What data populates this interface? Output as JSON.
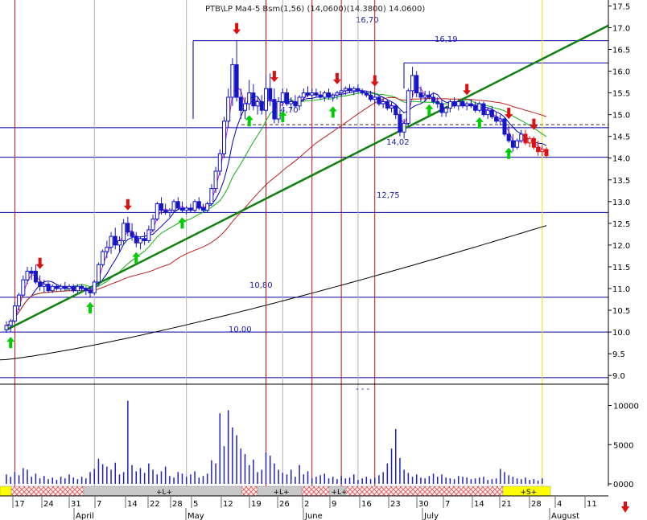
{
  "title_text": "PTB\\LP Ma4-5 Bsm(1,56) (14,0600)(14.3800) 14.0600)",
  "dashes_text": "- - -",
  "colors": {
    "up_candle": "#1414c8",
    "down_candle": "#e01010",
    "ma_short": "#d020d0",
    "ma_mid": "#0000c0",
    "ma_green": "#10b010",
    "ma_red": "#c02020",
    "ma_long": "#000000",
    "trend_line": "#108010",
    "level_line": "#0000a0",
    "vline_red": "#d01010",
    "vline_yellow": "#f0e000",
    "vline_gray": "#b0b0b0",
    "volume_bar": "#2020c0",
    "arrow_up": "#00cc00",
    "arrow_down": "#dd1010",
    "band_yellow": "#ffff00",
    "band_gray": "#c8c8c8",
    "band_hatch": "#ff8888"
  },
  "chart_data": {
    "type": "candlestick",
    "price_axis": {
      "ticks": [
        "17.5",
        "17.0",
        "16.5",
        "16.0",
        "15.5",
        "15.0",
        "14.5",
        "14.0",
        "13.5",
        "13.0",
        "12.5",
        "12.0",
        "11.5",
        "11.0",
        "10.5",
        "10.0",
        "9.5",
        "9.0"
      ],
      "range": [
        8.8,
        17.6
      ]
    },
    "volume_axis": {
      "ticks": [
        "10000",
        "5000",
        "0000"
      ],
      "range": [
        0,
        12000
      ]
    },
    "x_axis": {
      "day_ticks": [
        "17",
        "24",
        "31",
        "7",
        "14",
        "22",
        "28",
        "5",
        "12",
        "19",
        "26",
        "2",
        "9",
        "16",
        "23",
        "30",
        "7",
        "14",
        "21",
        "28",
        "4",
        "11"
      ],
      "months": [
        "April",
        "May",
        "June",
        "July",
        "August"
      ]
    },
    "levels": [
      {
        "value": 16.7,
        "label": "16,70"
      },
      {
        "value": 16.19,
        "label": "16,19"
      },
      {
        "value": 14.7,
        "label": "14,70"
      },
      {
        "value": 14.02,
        "label": "14,02"
      },
      {
        "value": 12.75,
        "label": "12,75"
      },
      {
        "value": 10.8,
        "label": "10,80"
      },
      {
        "value": 10.0,
        "label": "10,00"
      }
    ],
    "dashed_level": 14.77,
    "extra_level": 8.95,
    "trend_line": {
      "start": [
        0,
        10.05
      ],
      "end": [
        113,
        17.05
      ]
    },
    "vertical_lines": [
      {
        "day": 2,
        "kind": "red"
      },
      {
        "day": 21,
        "kind": "gray"
      },
      {
        "day": 43,
        "kind": "gray"
      },
      {
        "day": 62,
        "kind": "red"
      },
      {
        "day": 66,
        "kind": "gray"
      },
      {
        "day": 73,
        "kind": "red"
      },
      {
        "day": 80,
        "kind": "red"
      },
      {
        "day": 84,
        "kind": "gray"
      },
      {
        "day": 88,
        "kind": "red"
      },
      {
        "day": 128,
        "kind": "yellow"
      }
    ],
    "candles": [
      {
        "o": 10.05,
        "h": 10.25,
        "l": 9.98,
        "c": 10.15
      },
      {
        "o": 10.15,
        "h": 10.3,
        "l": 10.0,
        "c": 10.25
      },
      {
        "o": 10.25,
        "h": 10.7,
        "l": 10.2,
        "c": 10.6
      },
      {
        "o": 10.6,
        "h": 10.9,
        "l": 10.5,
        "c": 10.85
      },
      {
        "o": 10.85,
        "h": 11.3,
        "l": 10.8,
        "c": 11.2
      },
      {
        "o": 11.2,
        "h": 11.5,
        "l": 11.1,
        "c": 11.4
      },
      {
        "o": 11.4,
        "h": 11.5,
        "l": 11.2,
        "c": 11.35
      },
      {
        "o": 11.4,
        "h": 11.55,
        "l": 11.1,
        "c": 11.15
      },
      {
        "o": 11.15,
        "h": 11.3,
        "l": 10.95,
        "c": 11.05
      },
      {
        "o": 11.05,
        "h": 11.2,
        "l": 10.9,
        "c": 11.1
      },
      {
        "o": 11.1,
        "h": 11.15,
        "l": 10.9,
        "c": 10.95
      },
      {
        "o": 10.95,
        "h": 11.1,
        "l": 10.9,
        "c": 11.05
      },
      {
        "o": 11.05,
        "h": 11.1,
        "l": 10.95,
        "c": 11.0
      },
      {
        "o": 11.0,
        "h": 11.1,
        "l": 10.95,
        "c": 11.05
      },
      {
        "o": 11.05,
        "h": 11.15,
        "l": 10.95,
        "c": 11.0
      },
      {
        "o": 11.0,
        "h": 11.1,
        "l": 10.95,
        "c": 11.05
      },
      {
        "o": 11.05,
        "h": 11.1,
        "l": 10.9,
        "c": 10.95
      },
      {
        "o": 10.95,
        "h": 11.1,
        "l": 10.9,
        "c": 11.05
      },
      {
        "o": 11.05,
        "h": 11.1,
        "l": 10.95,
        "c": 11.0
      },
      {
        "o": 11.0,
        "h": 11.05,
        "l": 10.85,
        "c": 10.95
      },
      {
        "o": 10.95,
        "h": 11.05,
        "l": 10.8,
        "c": 10.9
      },
      {
        "o": 10.9,
        "h": 11.2,
        "l": 10.85,
        "c": 11.15
      },
      {
        "o": 11.15,
        "h": 11.6,
        "l": 11.1,
        "c": 11.55
      },
      {
        "o": 11.55,
        "h": 11.9,
        "l": 11.5,
        "c": 11.85
      },
      {
        "o": 11.85,
        "h": 12.1,
        "l": 11.7,
        "c": 11.95
      },
      {
        "o": 11.95,
        "h": 12.3,
        "l": 11.8,
        "c": 12.2
      },
      {
        "o": 12.2,
        "h": 12.4,
        "l": 11.9,
        "c": 12.0
      },
      {
        "o": 12.0,
        "h": 12.2,
        "l": 11.85,
        "c": 12.1
      },
      {
        "o": 12.1,
        "h": 12.6,
        "l": 12.0,
        "c": 12.5
      },
      {
        "o": 12.5,
        "h": 12.65,
        "l": 12.2,
        "c": 12.3
      },
      {
        "o": 12.3,
        "h": 12.5,
        "l": 12.1,
        "c": 12.2
      },
      {
        "o": 12.2,
        "h": 12.3,
        "l": 11.95,
        "c": 12.05
      },
      {
        "o": 12.05,
        "h": 12.2,
        "l": 11.9,
        "c": 12.15
      },
      {
        "o": 12.15,
        "h": 12.3,
        "l": 12.0,
        "c": 12.1
      },
      {
        "o": 12.1,
        "h": 12.45,
        "l": 12.05,
        "c": 12.35
      },
      {
        "o": 12.35,
        "h": 12.7,
        "l": 12.3,
        "c": 12.6
      },
      {
        "o": 12.6,
        "h": 13.0,
        "l": 12.55,
        "c": 12.95
      },
      {
        "o": 12.95,
        "h": 13.1,
        "l": 12.7,
        "c": 12.8
      },
      {
        "o": 12.8,
        "h": 12.95,
        "l": 12.7,
        "c": 12.75
      },
      {
        "o": 12.75,
        "h": 12.85,
        "l": 12.65,
        "c": 12.8
      },
      {
        "o": 12.8,
        "h": 13.05,
        "l": 12.75,
        "c": 13.0
      },
      {
        "o": 13.0,
        "h": 13.1,
        "l": 12.8,
        "c": 12.85
      },
      {
        "o": 12.85,
        "h": 13.0,
        "l": 12.75,
        "c": 12.8
      },
      {
        "o": 12.8,
        "h": 12.9,
        "l": 12.7,
        "c": 12.85
      },
      {
        "o": 12.85,
        "h": 12.95,
        "l": 12.75,
        "c": 12.8
      },
      {
        "o": 12.8,
        "h": 13.05,
        "l": 12.75,
        "c": 13.0
      },
      {
        "o": 13.0,
        "h": 13.1,
        "l": 12.8,
        "c": 12.85
      },
      {
        "o": 12.85,
        "h": 12.95,
        "l": 12.75,
        "c": 12.8
      },
      {
        "o": 12.8,
        "h": 13.0,
        "l": 12.75,
        "c": 12.95
      },
      {
        "o": 12.95,
        "h": 13.4,
        "l": 12.9,
        "c": 13.3
      },
      {
        "o": 13.3,
        "h": 13.8,
        "l": 13.2,
        "c": 13.7
      },
      {
        "o": 13.7,
        "h": 14.2,
        "l": 13.6,
        "c": 14.1
      },
      {
        "o": 14.1,
        "h": 14.95,
        "l": 14.0,
        "c": 14.85
      },
      {
        "o": 14.85,
        "h": 15.6,
        "l": 14.7,
        "c": 15.4
      },
      {
        "o": 15.4,
        "h": 16.3,
        "l": 15.2,
        "c": 16.15
      },
      {
        "o": 16.15,
        "h": 16.7,
        "l": 15.3,
        "c": 15.4
      },
      {
        "o": 15.4,
        "h": 15.6,
        "l": 14.9,
        "c": 15.1
      },
      {
        "o": 15.1,
        "h": 15.4,
        "l": 14.9,
        "c": 15.25
      },
      {
        "o": 15.25,
        "h": 15.8,
        "l": 15.1,
        "c": 15.5
      },
      {
        "o": 15.5,
        "h": 15.7,
        "l": 15.1,
        "c": 15.2
      },
      {
        "o": 15.2,
        "h": 15.4,
        "l": 15.0,
        "c": 15.3
      },
      {
        "o": 15.3,
        "h": 15.45,
        "l": 15.0,
        "c": 15.1
      },
      {
        "o": 15.1,
        "h": 15.9,
        "l": 15.0,
        "c": 15.6
      },
      {
        "o": 15.6,
        "h": 15.95,
        "l": 15.2,
        "c": 15.35
      },
      {
        "o": 15.35,
        "h": 15.6,
        "l": 14.8,
        "c": 14.9
      },
      {
        "o": 14.9,
        "h": 15.4,
        "l": 14.8,
        "c": 15.3
      },
      {
        "o": 15.3,
        "h": 15.6,
        "l": 15.2,
        "c": 15.5
      },
      {
        "o": 15.5,
        "h": 15.6,
        "l": 15.2,
        "c": 15.25
      },
      {
        "o": 15.25,
        "h": 15.4,
        "l": 15.1,
        "c": 15.3
      },
      {
        "o": 15.3,
        "h": 15.45,
        "l": 15.15,
        "c": 15.2
      },
      {
        "o": 15.2,
        "h": 15.45,
        "l": 15.1,
        "c": 15.4
      },
      {
        "o": 15.4,
        "h": 15.6,
        "l": 15.3,
        "c": 15.5
      },
      {
        "o": 15.5,
        "h": 15.65,
        "l": 15.4,
        "c": 15.45
      },
      {
        "o": 15.45,
        "h": 15.6,
        "l": 15.35,
        "c": 15.5
      },
      {
        "o": 15.5,
        "h": 15.6,
        "l": 15.4,
        "c": 15.45
      },
      {
        "o": 15.45,
        "h": 15.55,
        "l": 15.35,
        "c": 15.4
      },
      {
        "o": 15.4,
        "h": 15.55,
        "l": 15.3,
        "c": 15.5
      },
      {
        "o": 15.5,
        "h": 15.6,
        "l": 15.35,
        "c": 15.4
      },
      {
        "o": 15.4,
        "h": 15.5,
        "l": 15.3,
        "c": 15.45
      },
      {
        "o": 15.45,
        "h": 15.55,
        "l": 15.35,
        "c": 15.5
      },
      {
        "o": 15.5,
        "h": 15.6,
        "l": 15.4,
        "c": 15.55
      },
      {
        "o": 15.55,
        "h": 15.65,
        "l": 15.45,
        "c": 15.6
      },
      {
        "o": 15.6,
        "h": 15.7,
        "l": 15.5,
        "c": 15.55
      },
      {
        "o": 15.55,
        "h": 15.65,
        "l": 15.45,
        "c": 15.6
      },
      {
        "o": 15.6,
        "h": 15.7,
        "l": 15.5,
        "c": 15.55
      },
      {
        "o": 15.55,
        "h": 15.6,
        "l": 15.45,
        "c": 15.5
      },
      {
        "o": 15.5,
        "h": 15.55,
        "l": 15.4,
        "c": 15.45
      },
      {
        "o": 15.45,
        "h": 15.55,
        "l": 15.3,
        "c": 15.35
      },
      {
        "o": 15.35,
        "h": 15.5,
        "l": 15.25,
        "c": 15.4
      },
      {
        "o": 15.4,
        "h": 15.45,
        "l": 15.2,
        "c": 15.25
      },
      {
        "o": 15.25,
        "h": 15.4,
        "l": 15.15,
        "c": 15.3
      },
      {
        "o": 15.3,
        "h": 15.35,
        "l": 15.1,
        "c": 15.15
      },
      {
        "o": 15.15,
        "h": 15.3,
        "l": 15.05,
        "c": 15.2
      },
      {
        "o": 15.2,
        "h": 15.25,
        "l": 14.9,
        "c": 15.0
      },
      {
        "o": 15.0,
        "h": 15.1,
        "l": 14.5,
        "c": 14.6
      },
      {
        "o": 14.6,
        "h": 14.9,
        "l": 14.45,
        "c": 14.8
      },
      {
        "o": 14.8,
        "h": 15.6,
        "l": 14.75,
        "c": 15.55
      },
      {
        "o": 15.55,
        "h": 16.1,
        "l": 15.4,
        "c": 15.9
      },
      {
        "o": 15.9,
        "h": 16.0,
        "l": 15.4,
        "c": 15.5
      },
      {
        "o": 15.5,
        "h": 15.65,
        "l": 15.3,
        "c": 15.4
      },
      {
        "o": 15.4,
        "h": 15.55,
        "l": 15.3,
        "c": 15.45
      },
      {
        "o": 15.45,
        "h": 15.55,
        "l": 15.35,
        "c": 15.4
      },
      {
        "o": 15.4,
        "h": 15.5,
        "l": 15.25,
        "c": 15.3
      },
      {
        "o": 15.3,
        "h": 15.4,
        "l": 15.15,
        "c": 15.25
      },
      {
        "o": 15.25,
        "h": 15.35,
        "l": 14.95,
        "c": 15.05
      },
      {
        "o": 15.05,
        "h": 15.2,
        "l": 14.95,
        "c": 15.15
      },
      {
        "o": 15.15,
        "h": 15.35,
        "l": 15.05,
        "c": 15.3
      },
      {
        "o": 15.3,
        "h": 15.4,
        "l": 15.15,
        "c": 15.2
      },
      {
        "o": 15.2,
        "h": 15.35,
        "l": 15.1,
        "c": 15.3
      },
      {
        "o": 15.3,
        "h": 15.35,
        "l": 15.15,
        "c": 15.2
      },
      {
        "o": 15.2,
        "h": 15.3,
        "l": 15.1,
        "c": 15.25
      },
      {
        "o": 15.25,
        "h": 15.35,
        "l": 15.15,
        "c": 15.2
      },
      {
        "o": 15.2,
        "h": 15.3,
        "l": 15.05,
        "c": 15.1
      },
      {
        "o": 15.1,
        "h": 15.3,
        "l": 15.05,
        "c": 15.25
      },
      {
        "o": 15.25,
        "h": 15.3,
        "l": 14.95,
        "c": 15.0
      },
      {
        "o": 15.0,
        "h": 15.15,
        "l": 14.9,
        "c": 15.1
      },
      {
        "o": 15.1,
        "h": 15.2,
        "l": 14.9,
        "c": 14.95
      },
      {
        "o": 14.95,
        "h": 15.05,
        "l": 14.8,
        "c": 14.85
      },
      {
        "o": 14.85,
        "h": 15.0,
        "l": 14.75,
        "c": 14.9
      },
      {
        "o": 14.9,
        "h": 14.95,
        "l": 14.5,
        "c": 14.55
      },
      {
        "o": 14.55,
        "h": 14.75,
        "l": 14.35,
        "c": 14.4
      },
      {
        "o": 14.4,
        "h": 14.55,
        "l": 14.15,
        "c": 14.25
      },
      {
        "o": 14.25,
        "h": 14.45,
        "l": 14.2,
        "c": 14.4
      },
      {
        "o": 14.4,
        "h": 14.65,
        "l": 14.35,
        "c": 14.55
      },
      {
        "o": 14.55,
        "h": 14.65,
        "l": 14.3,
        "c": 14.35
      },
      {
        "o": 14.35,
        "h": 14.5,
        "l": 14.25,
        "c": 14.45
      },
      {
        "o": 14.45,
        "h": 14.5,
        "l": 14.2,
        "c": 14.25
      },
      {
        "o": 14.25,
        "h": 14.4,
        "l": 14.05,
        "c": 14.15
      },
      {
        "o": 14.15,
        "h": 14.3,
        "l": 14.05,
        "c": 14.2
      },
      {
        "o": 14.2,
        "h": 14.25,
        "l": 14.0,
        "c": 14.06
      }
    ],
    "volume": [
      1200,
      900,
      1500,
      1100,
      2000,
      1800,
      900,
      1300,
      700,
      1000,
      600,
      800,
      500,
      900,
      700,
      1200,
      800,
      600,
      900,
      700,
      1500,
      1900,
      3200,
      2500,
      2200,
      1800,
      2700,
      1200,
      1500,
      10600,
      2400,
      1600,
      2000,
      1400,
      2600,
      1800,
      1200,
      1600,
      2200,
      1000,
      800,
      1500,
      1300,
      900,
      1200,
      1600,
      800,
      1000,
      1300,
      3000,
      2600,
      9000,
      4800,
      9400,
      7200,
      6200,
      4500,
      3800,
      2400,
      3100,
      1500,
      1800,
      4000,
      3600,
      2600,
      1800,
      1400,
      1200,
      1800,
      900,
      2400,
      1200,
      1600,
      700,
      900,
      1100,
      1300,
      700,
      900,
      600,
      1000,
      700,
      800,
      1200,
      500,
      700,
      900,
      600,
      800,
      1100,
      1500,
      2600,
      4500,
      7000,
      3300,
      1800,
      1400,
      900,
      1200,
      800,
      700,
      1000,
      1300,
      900,
      1200,
      800,
      700,
      600,
      1000,
      900,
      800,
      600,
      700,
      800,
      900,
      500,
      600,
      700,
      1900,
      1500,
      1100,
      900,
      700,
      600,
      800,
      500,
      600,
      400,
      700
    ]
  }
}
